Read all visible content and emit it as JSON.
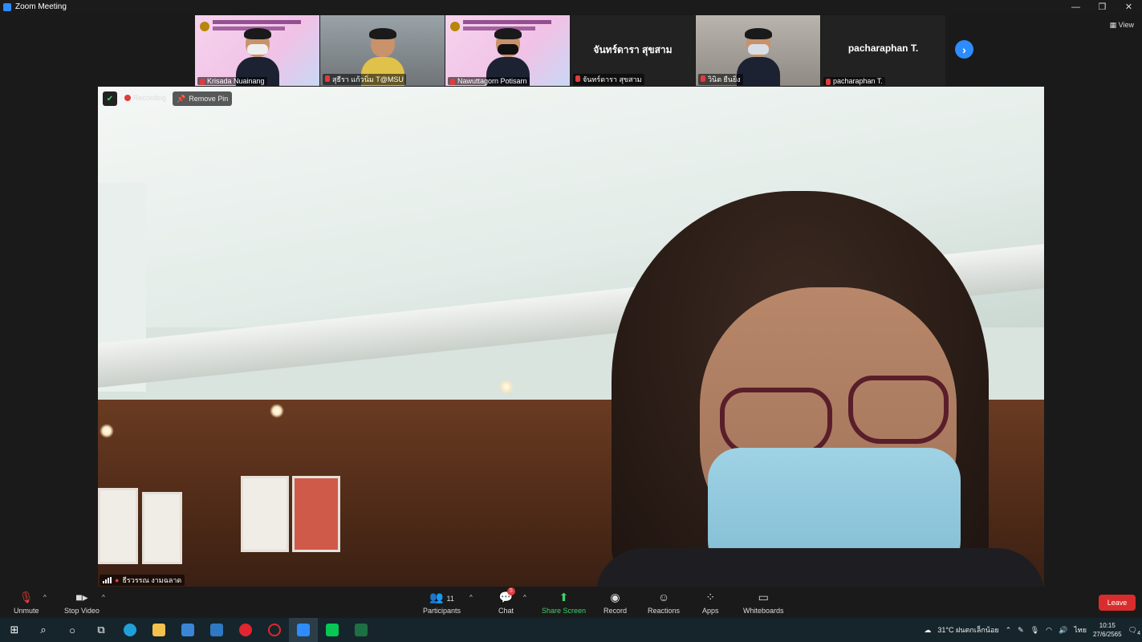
{
  "window": {
    "title": "Zoom Meeting",
    "minimize": "—",
    "restore": "❐",
    "close": "✕"
  },
  "gallery": {
    "tiles": [
      {
        "name": "Krisada Nuainang",
        "type": "banner-video"
      },
      {
        "name": "สุธีรา แก้วนิ่ม T@MSU",
        "type": "video"
      },
      {
        "name": "Nawuttagorn Potisarn",
        "type": "banner-video"
      },
      {
        "name": "จันทร์ดารา สุขสาม",
        "type": "no-video",
        "center_name": "จันทร์ดารา สุขสาม"
      },
      {
        "name": "วินิต ยืนยิ่ง",
        "type": "video"
      },
      {
        "name": "pacharaphan T.",
        "type": "no-video",
        "center_name": "pacharaphan T."
      }
    ],
    "next_label": "›",
    "view_label": "View"
  },
  "main_video": {
    "recording_label": "Recording",
    "remove_pin_label": "Remove Pin",
    "speaker_name": "ธีรวรรณ งามฉลาด"
  },
  "toolbar": {
    "unmute": "Unmute",
    "stop_video": "Stop Video",
    "participants": "Participants",
    "participants_count": "11",
    "chat": "Chat",
    "chat_badge": "5",
    "share_screen": "Share Screen",
    "record": "Record",
    "reactions": "Reactions",
    "apps": "Apps",
    "whiteboards": "Whiteboards",
    "leave": "Leave"
  },
  "taskbar": {
    "weather": "31°C ฝนตกเล็กน้อย",
    "language": "ไทย",
    "time": "10:15",
    "date": "27/6/2565",
    "notifications": "4"
  },
  "colors": {
    "accent": "#2d8cff",
    "leave": "#d92d2d",
    "share": "#3fd16a"
  }
}
